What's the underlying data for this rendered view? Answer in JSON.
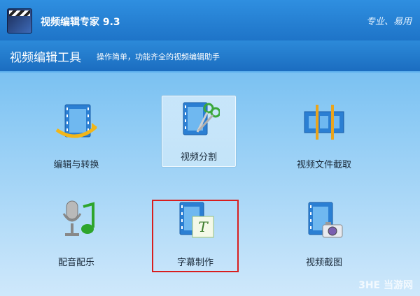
{
  "app": {
    "title": "视频编辑专家 9.3",
    "slogan": "专业、易用"
  },
  "header": {
    "title": "视频编辑工具",
    "description": "操作简单，功能齐全的视频编辑助手"
  },
  "tools": [
    {
      "label": "编辑与转换",
      "icon": "film-arrow-icon"
    },
    {
      "label": "视频分割",
      "icon": "film-scissors-icon"
    },
    {
      "label": "视频文件截取",
      "icon": "film-trim-icon"
    },
    {
      "label": "配音配乐",
      "icon": "microphone-music-icon"
    },
    {
      "label": "字幕制作",
      "icon": "subtitle-icon"
    },
    {
      "label": "视频截图",
      "icon": "film-camera-icon"
    }
  ],
  "watermark": "3HE 当游网",
  "colors": {
    "highlight": "#d81e1e",
    "header_blue": "#1e74c8",
    "accent_green": "#2ea52c"
  }
}
